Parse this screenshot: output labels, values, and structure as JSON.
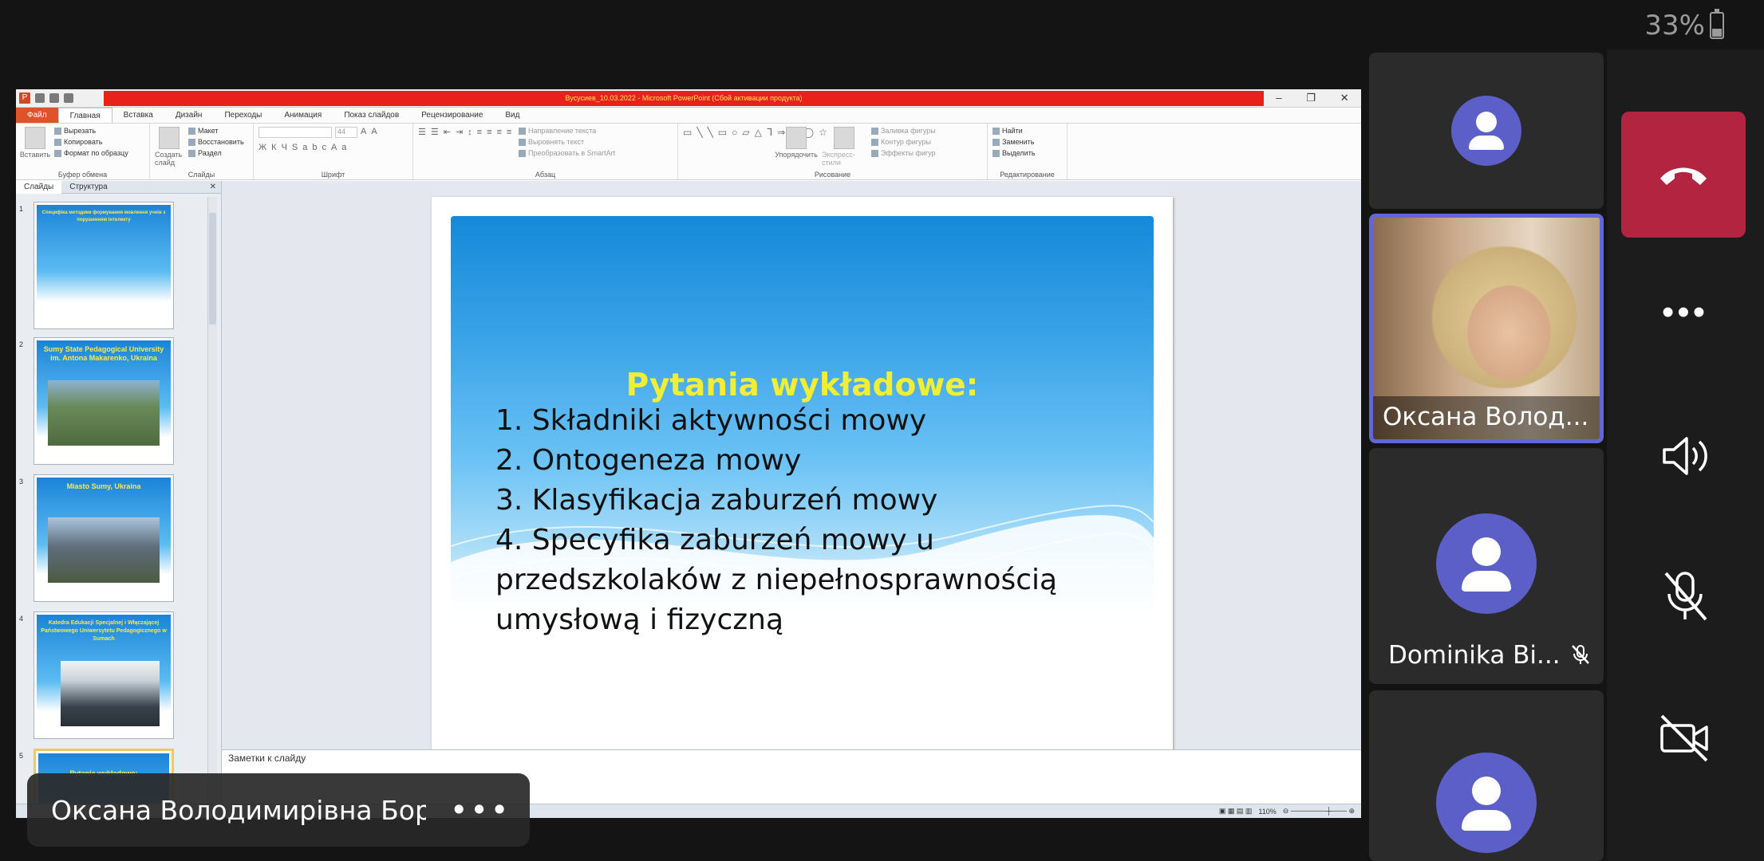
{
  "status_bar": {
    "battery_percent": "33%",
    "battery_level": 0.33
  },
  "ppt": {
    "window_title": "Вусусиев_10.03.2022 - Microsoft PowerPoint (Сбой активации продукта)",
    "tabs": [
      "Файл",
      "Главная",
      "Вставка",
      "Дизайн",
      "Переходы",
      "Анимация",
      "Показ слайдов",
      "Рецензирование",
      "Вид"
    ],
    "ribbon": {
      "clipboard": {
        "paste": "Вставить",
        "cut": "Вырезать",
        "copy": "Копировать",
        "format_painter": "Формат по образцу",
        "group": "Буфер обмена"
      },
      "slides": {
        "new_slide": "Создать слайд",
        "layout": "Макет",
        "reset": "Восстановить",
        "section": "Раздел",
        "group": "Слайды"
      },
      "font": {
        "group": "Шрифт",
        "size": "44"
      },
      "paragraph": {
        "text_direction": "Направление текста",
        "align_text": "Выровнять текст",
        "smartart": "Преобразовать в SmartArt",
        "group": "Абзац"
      },
      "drawing": {
        "arrange": "Упорядочить",
        "quick_styles": "Экспресс-стили",
        "shape_fill": "Заливка фигуры",
        "shape_outline": "Контур фигуры",
        "shape_effects": "Эффекты фигур",
        "group": "Рисование"
      },
      "editing": {
        "find": "Найти",
        "replace": "Заменить",
        "select": "Выделить",
        "group": "Редактирование"
      }
    },
    "panel_tabs": [
      "Слайды",
      "Структура"
    ],
    "thumbnails": [
      {
        "num": "1",
        "title": "Специфіка методики формування мовлення учнів з порушенням інтелекту"
      },
      {
        "num": "2",
        "title": "Sumy State Pedagogical University im. Antona Makarenko, Ukraina"
      },
      {
        "num": "3",
        "title": "Miasto Sumy, Ukraina"
      },
      {
        "num": "4",
        "title": "Katedra Edukacji Specjalnej i Włączającej Państwowego Uniwersytetu Pedagogicznego w Sumach"
      },
      {
        "num": "5",
        "title": "Pytania wykładowe:"
      }
    ],
    "slide": {
      "heading": "Pytania wykładowe:",
      "items": [
        "1. Składniki aktywności mowy",
        "2. Ontogeneza mowy",
        "3. Klasyfikacja zaburzeń mowy",
        "4. Specyfika zaburzeń mowy u przedszkolaków z niepełnosprawnością umysłową i fizyczną"
      ]
    },
    "notes_placeholder": "Заметки к слайду",
    "zoom": "110%"
  },
  "presenter": {
    "name": "Оксана Володимирівна Бор...",
    "more": "•••"
  },
  "participants": [
    {
      "name": "",
      "type": "avatar"
    },
    {
      "name": "Оксана Волод...",
      "type": "video"
    },
    {
      "name": "Dominika Bi...",
      "type": "avatar",
      "muted": true
    },
    {
      "name": "",
      "type": "avatar"
    }
  ],
  "controls": {
    "more": "•••"
  },
  "colors": {
    "accent": "#5b5fc7",
    "hangup": "#b32441",
    "slide_heading": "#f2ee34"
  }
}
